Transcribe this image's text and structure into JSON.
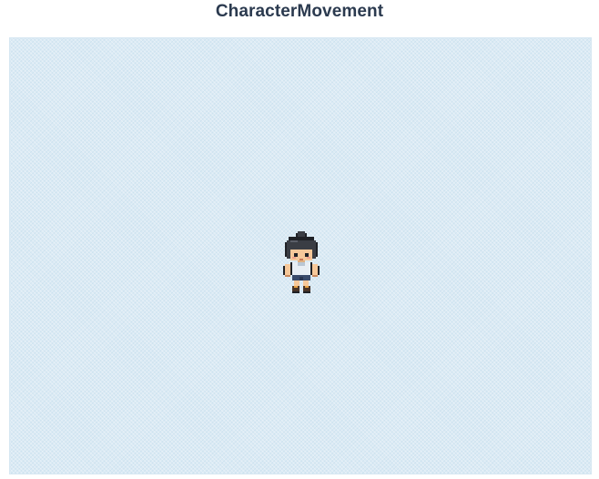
{
  "page": {
    "title": "CharacterMovement"
  },
  "stage": {
    "background_color": "#dbeaf4"
  },
  "character": {
    "sprite": "pixel-girl-front-facing",
    "facing": "down",
    "colors": {
      "hair": "#3a3d44",
      "skin": "#f6c89a",
      "outfit": "#e8eef4",
      "shorts": "#3a4a6a",
      "shoes": "#4a3528",
      "outline": "#1f2126"
    }
  }
}
